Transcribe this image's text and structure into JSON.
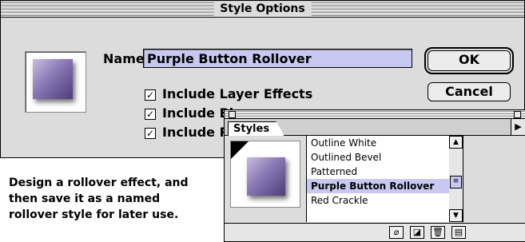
{
  "dialog": {
    "title": "Style Options",
    "name_label": "Name:",
    "name_value": "Purple Button Rollover",
    "checkboxes": [
      {
        "label": "Include Layer Effects",
        "checked": true
      },
      {
        "label": "Include Bl",
        "checked": true
      },
      {
        "label": "Include Re",
        "checked": true
      }
    ],
    "ok_label": "OK",
    "cancel_label": "Cancel",
    "checkmark": "☑"
  },
  "palette": {
    "tab_label": "Styles",
    "items": [
      "Outline White",
      "Outlined Bevel",
      "Patterned",
      "Purple Button Rollover",
      "Red Crackle"
    ],
    "selected_index": 3
  },
  "caption": {
    "lines": [
      "Design a rollover effect, and",
      "then save it as a named",
      "rollover style for later use."
    ]
  },
  "colors": {
    "selection": "#c9c8f0",
    "swatch": "#7b6aa8"
  }
}
